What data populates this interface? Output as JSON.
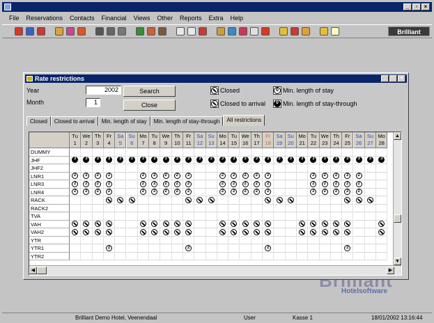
{
  "menu": [
    "File",
    "Reservations",
    "Contacts",
    "Financial",
    "Views",
    "Other",
    "Reports",
    "Extra",
    "Help"
  ],
  "brand": "Brilliant",
  "watermark": {
    "name": "Brilliant",
    "sub": "Hotelsoftware"
  },
  "status": {
    "hotel": "Brilliant Demo Hotel, Veenendaal",
    "user": "User",
    "register": "Kasse 1",
    "datetime": "18/01/2002  13:16:44"
  },
  "dialog": {
    "title": "Rate restrictions",
    "year_label": "Year",
    "year_value": "2002",
    "month_label": "Month",
    "month_value": "1",
    "search_label": "Search",
    "close_label": "Close",
    "legend": {
      "closed": "Closed",
      "closed_arrival": "Closed to arrival",
      "min_stay": "Min. length of stay",
      "min_through": "Min. length of stay-through"
    },
    "tabs": [
      "Closed",
      "Closed to arrival",
      "Min. length of stay",
      "Min. length of stay-through",
      "All restrictions"
    ],
    "active_tab": 4
  },
  "grid": {
    "days": [
      {
        "dow": "Tu",
        "d": "1",
        "t": "n"
      },
      {
        "dow": "We",
        "d": "2",
        "t": "n"
      },
      {
        "dow": "Th",
        "d": "3",
        "t": "n"
      },
      {
        "dow": "Fr",
        "d": "4",
        "t": "n"
      },
      {
        "dow": "Sa",
        "d": "5",
        "t": "we"
      },
      {
        "dow": "Su",
        "d": "6",
        "t": "we"
      },
      {
        "dow": "Mo",
        "d": "7",
        "t": "n"
      },
      {
        "dow": "Tu",
        "d": "8",
        "t": "n"
      },
      {
        "dow": "We",
        "d": "9",
        "t": "n"
      },
      {
        "dow": "Th",
        "d": "10",
        "t": "n"
      },
      {
        "dow": "Fr",
        "d": "11",
        "t": "n"
      },
      {
        "dow": "Sa",
        "d": "12",
        "t": "we"
      },
      {
        "dow": "Su",
        "d": "13",
        "t": "we"
      },
      {
        "dow": "Mo",
        "d": "14",
        "t": "n"
      },
      {
        "dow": "Tu",
        "d": "15",
        "t": "n"
      },
      {
        "dow": "We",
        "d": "16",
        "t": "n"
      },
      {
        "dow": "Th",
        "d": "17",
        "t": "n"
      },
      {
        "dow": "Fr",
        "d": "18",
        "t": "hol"
      },
      {
        "dow": "Sa",
        "d": "19",
        "t": "we"
      },
      {
        "dow": "Su",
        "d": "20",
        "t": "we"
      },
      {
        "dow": "Mo",
        "d": "21",
        "t": "n"
      },
      {
        "dow": "Tu",
        "d": "22",
        "t": "n"
      },
      {
        "dow": "We",
        "d": "23",
        "t": "n"
      },
      {
        "dow": "Th",
        "d": "24",
        "t": "n"
      },
      {
        "dow": "Fr",
        "d": "25",
        "t": "n"
      },
      {
        "dow": "Sa",
        "d": "26",
        "t": "we"
      },
      {
        "dow": "Su",
        "d": "27",
        "t": "we"
      },
      {
        "dow": "Mo",
        "d": "28",
        "t": "n"
      }
    ],
    "rows": [
      {
        "name": "DUMMY",
        "cells": "............................"
      },
      {
        "name": "JHF",
        "cells": "3333333333333333333333333333"
      },
      {
        "name": "JHF2",
        "cells": "............................"
      },
      {
        "name": "LNR1",
        "cells": "2222..22222..22222...22222..2"
      },
      {
        "name": "LNR3",
        "cells": "2222..22222..22222...22222..2"
      },
      {
        "name": "LNR4",
        "cells": "2222..22222..22222...22222..2"
      },
      {
        "name": "RACK",
        "cells": "...XXX....XXX....XXX....XXX."
      },
      {
        "name": "RACK2",
        "cells": "............................"
      },
      {
        "name": "TVA",
        "cells": "............................"
      },
      {
        "name": "VAH",
        "cells": "XXXX..XXXXX..XXXXX..XXXXX..X"
      },
      {
        "name": "VAH2",
        "cells": "XXXX..XXXXX..XXXXX..XXXXX..X"
      },
      {
        "name": "YTR",
        "cells": "............................"
      },
      {
        "name": "YTR1",
        "cells": "...2......2......2......2..."
      },
      {
        "name": "YTR2",
        "cells": "............................"
      }
    ]
  }
}
